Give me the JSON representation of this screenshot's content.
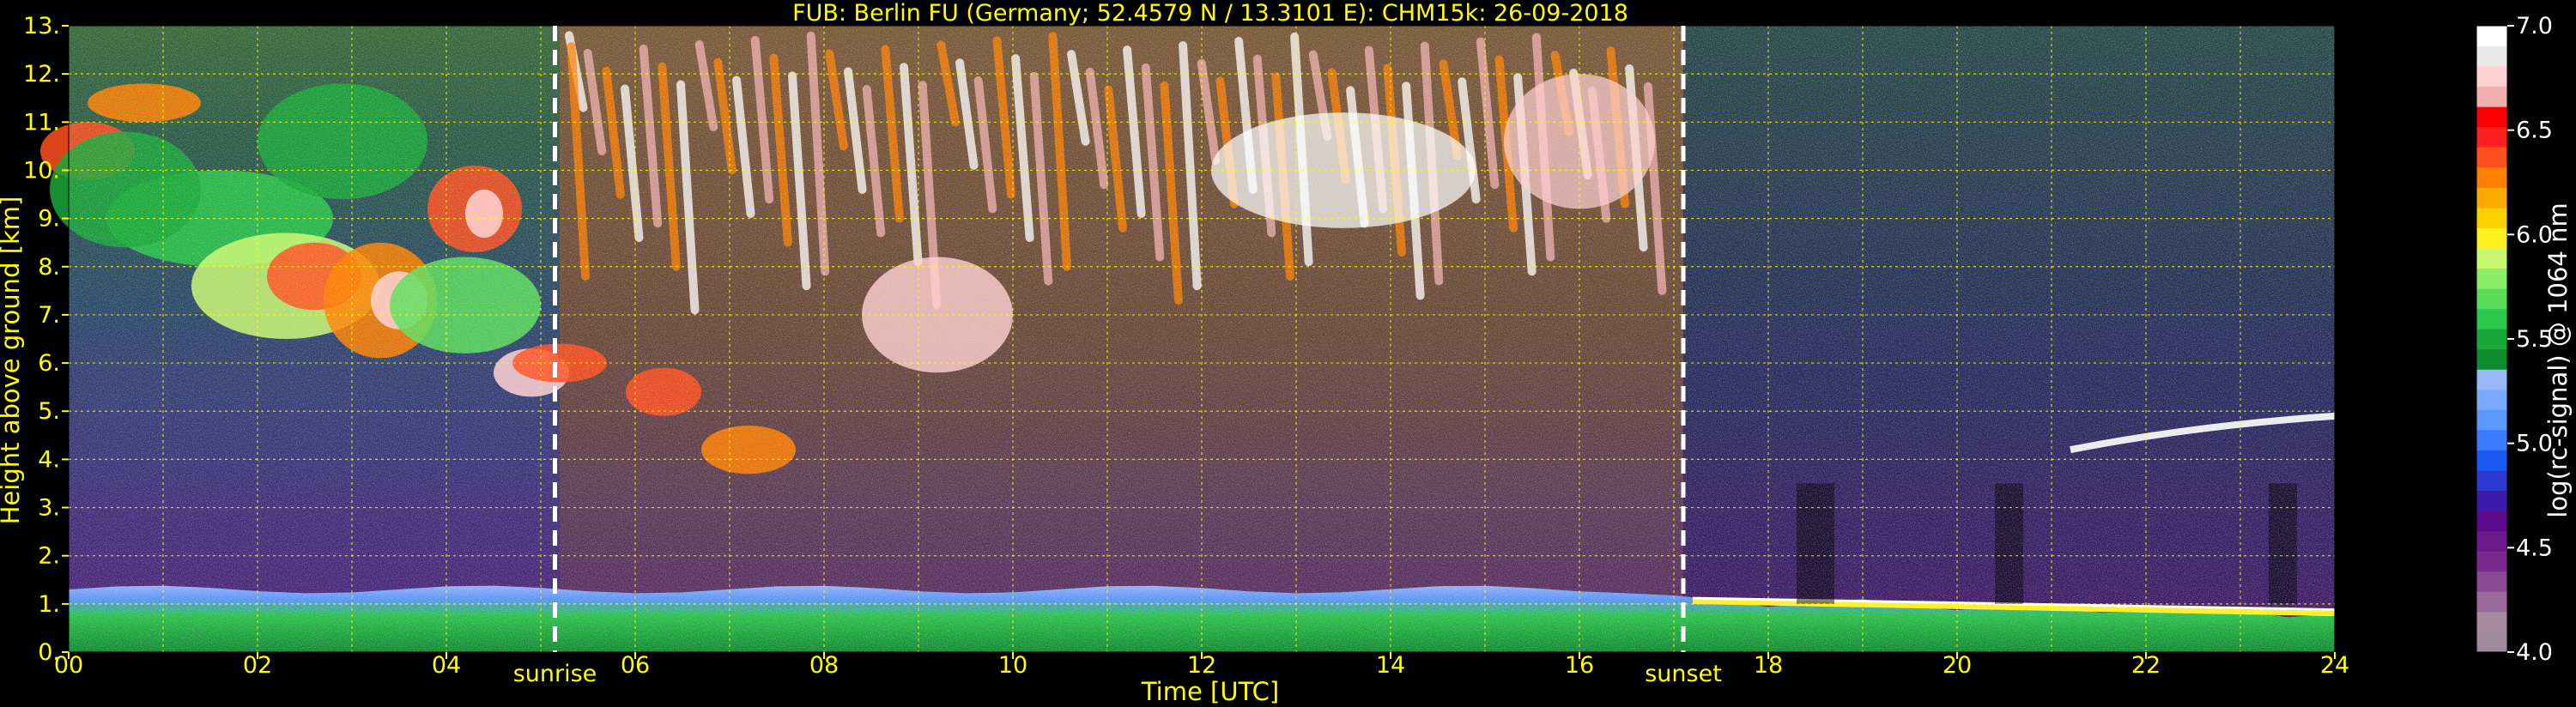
{
  "chart_data": {
    "type": "heatmap",
    "title": "FUB: Berlin FU (Germany; 52.4579 N / 13.3101 E):    CHM15k: 26-09-2018",
    "xlabel": "Time [UTC]",
    "ylabel": "Height above ground [km]",
    "xlim": [
      0,
      24
    ],
    "ylim": [
      0,
      13
    ],
    "x_ticks": [
      "00",
      "02",
      "04",
      "06",
      "08",
      "10",
      "12",
      "14",
      "16",
      "18",
      "20",
      "22",
      "24"
    ],
    "y_ticks": [
      "0.",
      "1.",
      "2.",
      "3.",
      "4.",
      "5.",
      "6.",
      "7.",
      "8.",
      "9.",
      "10.",
      "11.",
      "12.",
      "13."
    ],
    "grid": true,
    "events": [
      {
        "label": "sunrise",
        "x": 5.15
      },
      {
        "label": "sunset",
        "x": 17.1
      }
    ],
    "colorbar": {
      "label": "log(rc-signal) @ 1064 nm",
      "range": [
        4.0,
        7.0
      ],
      "ticks": [
        "4.0",
        "4.5",
        "5.0",
        "5.5",
        "6.0",
        "6.5",
        "7.0"
      ],
      "colors": [
        "#9e8a9a",
        "#a88aa0",
        "#9a6a9a",
        "#8a4a94",
        "#7a2a8e",
        "#6a1a8a",
        "#5a0a8a",
        "#3a1aaa",
        "#2a3ad0",
        "#1a5af0",
        "#3a7aff",
        "#5a9aff",
        "#7aaaff",
        "#9ab8f8",
        "#0e8e2e",
        "#1aa83a",
        "#2ac84a",
        "#5ade5a",
        "#8aee6a",
        "#c8f870",
        "#fff020",
        "#ffd000",
        "#ffaa00",
        "#ff8000",
        "#ff5020",
        "#ff2020",
        "#ff0000",
        "#f0b0b0",
        "#ffd0d0",
        "#e8e8e8",
        "#ffffff"
      ]
    },
    "layers": [
      {
        "name": "boundary-layer",
        "x": [
          0,
          24
        ],
        "height_km": [
          0,
          1.3
        ],
        "value": 5.2
      },
      {
        "name": "clouds-morning",
        "x": [
          0,
          5.2
        ],
        "height_km": [
          5.0,
          12.0
        ],
        "value": 6.0
      },
      {
        "name": "cirrus-day",
        "x": [
          5.2,
          17.0
        ],
        "height_km": [
          5.5,
          13.0
        ],
        "value": 6.7
      },
      {
        "name": "clouds-evening",
        "x": [
          21,
          24
        ],
        "height_km": [
          4.0,
          5.0
        ],
        "value": 6.8
      }
    ]
  }
}
